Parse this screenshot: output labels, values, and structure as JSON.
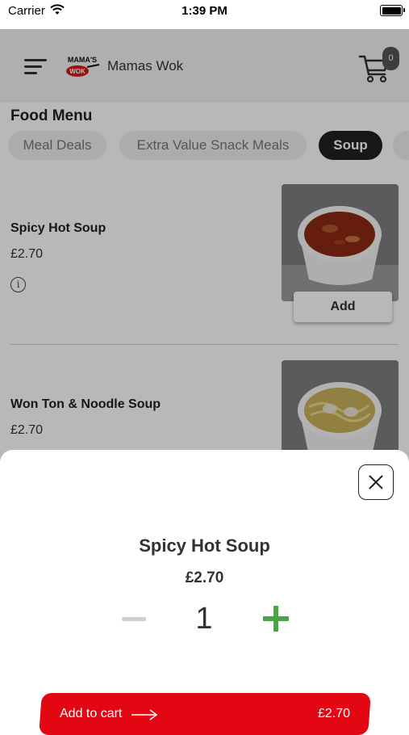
{
  "status_bar": {
    "carrier": "Carrier",
    "time": "1:39 PM"
  },
  "header": {
    "brand": "Mamas Wok",
    "cart_count": "0",
    "logo_text": "MAMA'S WOK"
  },
  "menu": {
    "title": "Food Menu",
    "tabs": [
      {
        "label": "Meal Deals"
      },
      {
        "label": "Extra Value Snack Meals"
      },
      {
        "label": "Soup",
        "active": true
      }
    ],
    "items": [
      {
        "name": "Spicy Hot Soup",
        "price": "£2.70",
        "add_label": "Add",
        "info": "i"
      },
      {
        "name": "Won Ton & Noodle Soup",
        "price": "£2.70"
      }
    ]
  },
  "sheet": {
    "title": "Spicy Hot Soup",
    "price": "£2.70",
    "quantity": "1",
    "cta_label": "Add to cart",
    "cta_price": "£2.70"
  },
  "colors": {
    "accent_red": "#e30613",
    "plus_green": "#4aa447",
    "active_tab": "#202020"
  }
}
